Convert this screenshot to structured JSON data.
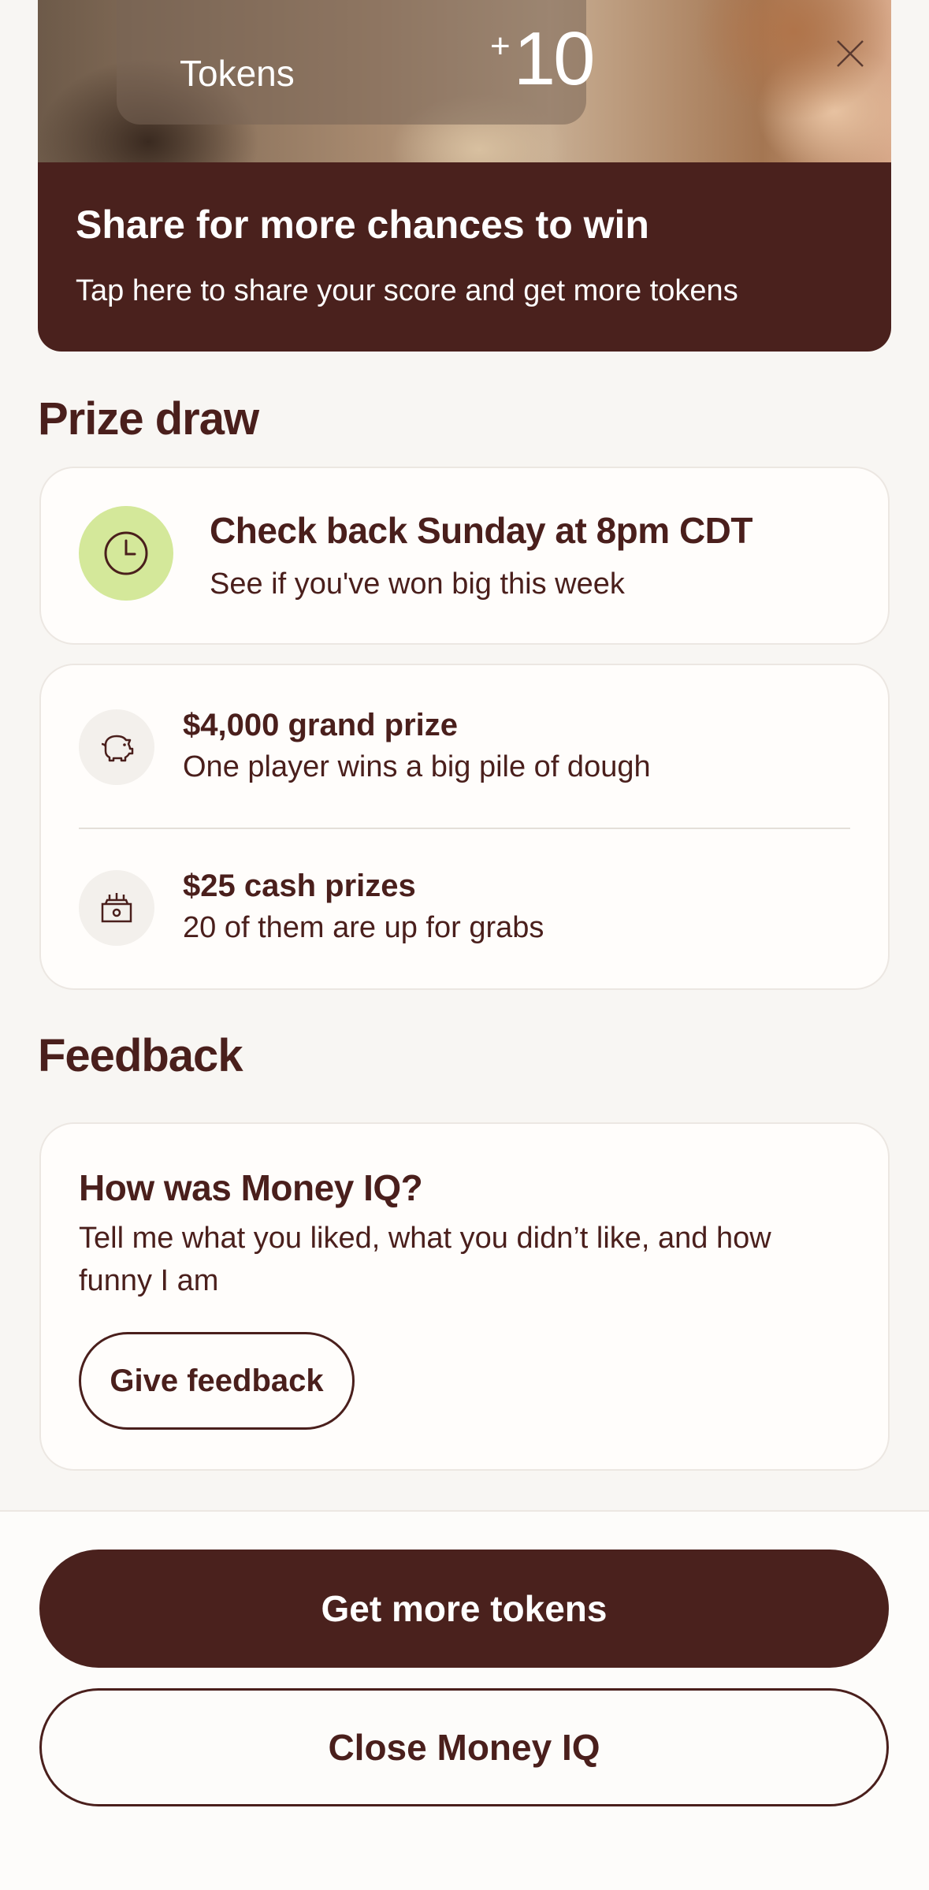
{
  "share_card": {
    "token_label": "Tokens",
    "token_plus": "+",
    "token_value": "10",
    "title": "Share for more chances to win",
    "subtitle": "Tap here to share your score and get more tokens"
  },
  "prize_draw": {
    "heading": "Prize draw",
    "draw_card": {
      "icon": "clock-icon",
      "title": "Check back Sunday at 8pm CDT",
      "subtitle": "See if you've won big this week"
    },
    "prizes": [
      {
        "icon": "piggy-bank-icon",
        "title": "$4,000 grand prize",
        "subtitle": "One player wins a big pile of dough"
      },
      {
        "icon": "cash-register-icon",
        "title": "$25 cash prizes",
        "subtitle": "20 of them are up for grabs"
      }
    ]
  },
  "feedback": {
    "heading": "Feedback",
    "title": "How was Money IQ?",
    "body": "Tell me what you liked, what you didn’t like, and how funny I am",
    "button": "Give feedback"
  },
  "actions": {
    "primary": "Get more tokens",
    "secondary": "Close Money IQ"
  },
  "colors": {
    "brand": "#4a211d",
    "clock_bg": "#d4e89a",
    "background": "#f8f6f3"
  }
}
